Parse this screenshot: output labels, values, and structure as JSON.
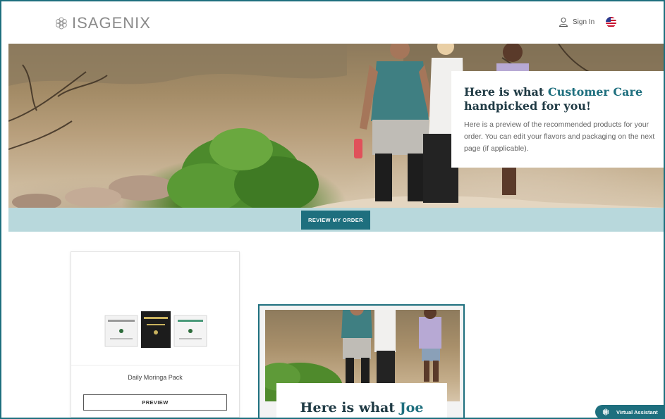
{
  "header": {
    "logo_text": "ISAGENIX",
    "sign_in_label": "Sign In",
    "flag_icon": "us-flag-icon"
  },
  "hero": {
    "title_prefix": "Here is what ",
    "title_accent": "Customer Care",
    "title_suffix": "handpicked for you!",
    "description_line1": "Here is a preview of the recommended products for your",
    "description_line2": "order. You can edit your flavors and packaging on the next",
    "description_line3": "page (if applicable)."
  },
  "band": {
    "review_button_label": "REVIEW MY ORDER"
  },
  "product": {
    "name": "Daily Moringa Pack",
    "preview_button_label": "PREVIEW"
  },
  "email_preview": {
    "title_prefix": "Here is what ",
    "title_accent": "Joe"
  },
  "assistant": {
    "label": "Virtual Assistant"
  },
  "colors": {
    "brand_teal": "#1e6f7e",
    "band_light": "#b8d8dc",
    "logo_gray": "#8a8a8a"
  }
}
